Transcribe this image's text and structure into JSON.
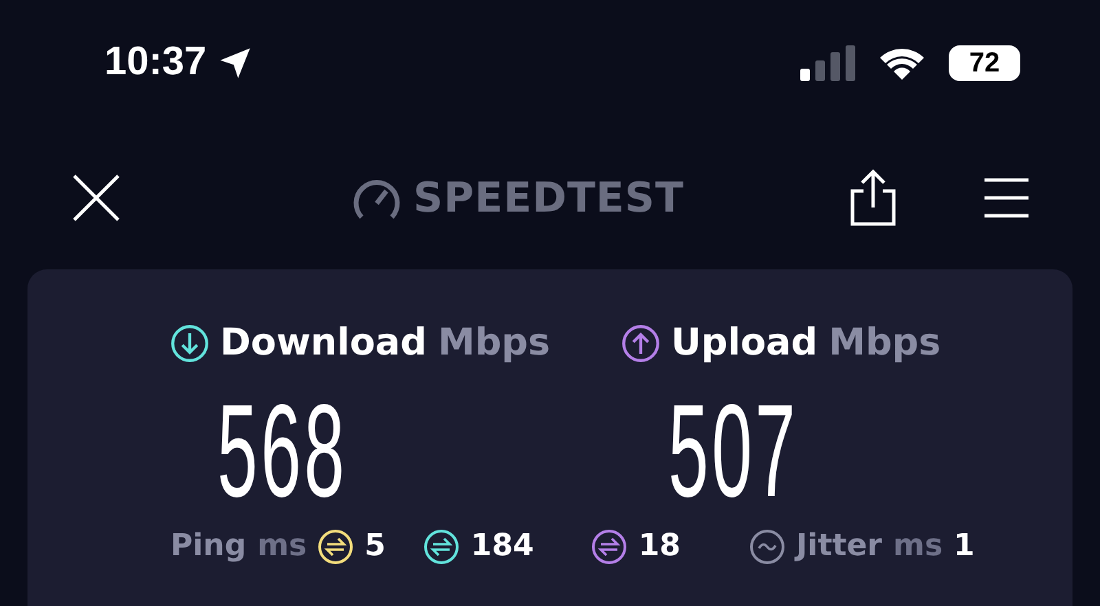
{
  "status_bar": {
    "time": "10:37",
    "battery": "72"
  },
  "header": {
    "title": "SPEEDTEST"
  },
  "results": [
    {
      "kind": "download",
      "label": "Download",
      "unit": "Mbps",
      "value": "568"
    },
    {
      "kind": "upload",
      "label": "Upload",
      "unit": "Mbps",
      "value": "507"
    }
  ],
  "ping": {
    "label": "Ping",
    "unit": "ms",
    "values": [
      {
        "value": "5",
        "color": "#f3dd7c"
      },
      {
        "value": "184",
        "color": "#62e3dc"
      },
      {
        "value": "18",
        "color": "#b47fe8"
      }
    ]
  },
  "jitter": {
    "label": "Jitter",
    "unit": "ms",
    "value": "1"
  }
}
